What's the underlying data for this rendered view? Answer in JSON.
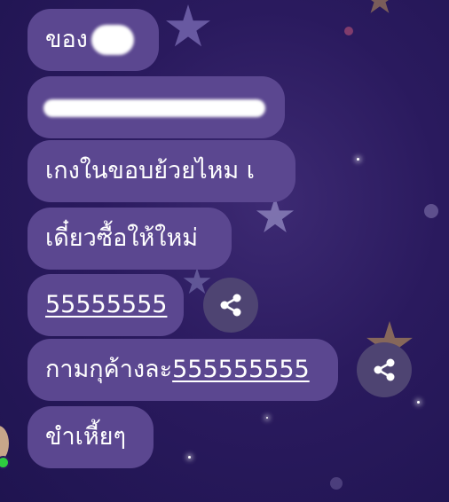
{
  "messages": [
    {
      "text": "ของ",
      "has_redaction": true
    },
    {
      "text": "",
      "has_redaction": true
    },
    {
      "text": "เกงในขอบย้วยไหม เ"
    },
    {
      "text": "เดี๋ยวซื้อให้ใหม่"
    },
    {
      "text": "55555555",
      "underlined": true,
      "share": true
    },
    {
      "prefix": "กามกุค้างละ",
      "link": "555555555",
      "share": true
    },
    {
      "text": "ขำเหี้ยๆ"
    }
  ],
  "icons": {
    "share": "share-icon",
    "avatar": "avatar",
    "online": "online-status-dot"
  },
  "colors": {
    "bubble": "#5b4790",
    "background": "#2a1a5e",
    "share_button": "#4e4472",
    "online": "#2ecc40"
  }
}
